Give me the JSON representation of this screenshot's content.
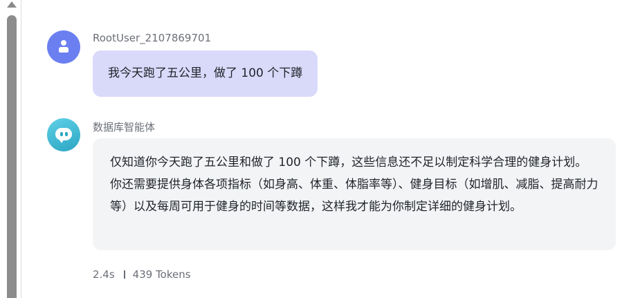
{
  "messages": {
    "user": {
      "name": "RootUser_2107869701",
      "text": "我今天跑了五公里，做了 100 个下蹲"
    },
    "assistant": {
      "name": "数据库智能体",
      "text": "仅知道你今天跑了五公里和做了 100 个下蹲，这些信息还不足以制定科学合理的健身计划。你还需要提供身体各项指标（如身高、体重、体脂率等）、健身目标（如增肌、减脂、提高耐力等）以及每周可用于健身的时间等数据，这样我才能为你制定详细的健身计划。",
      "time": "2.4s",
      "tokens": "439 Tokens"
    }
  },
  "icons": {
    "user_avatar": "person-icon",
    "assistant_avatar": "chat-bubble-icon",
    "scroll_up": "triangle-up-icon"
  },
  "colors": {
    "user_avatar": "#6b7ff0",
    "assistant_avatar": "#2ca6c4",
    "user_bubble": "#d9dafa",
    "assistant_bubble": "#f3f4f6"
  }
}
